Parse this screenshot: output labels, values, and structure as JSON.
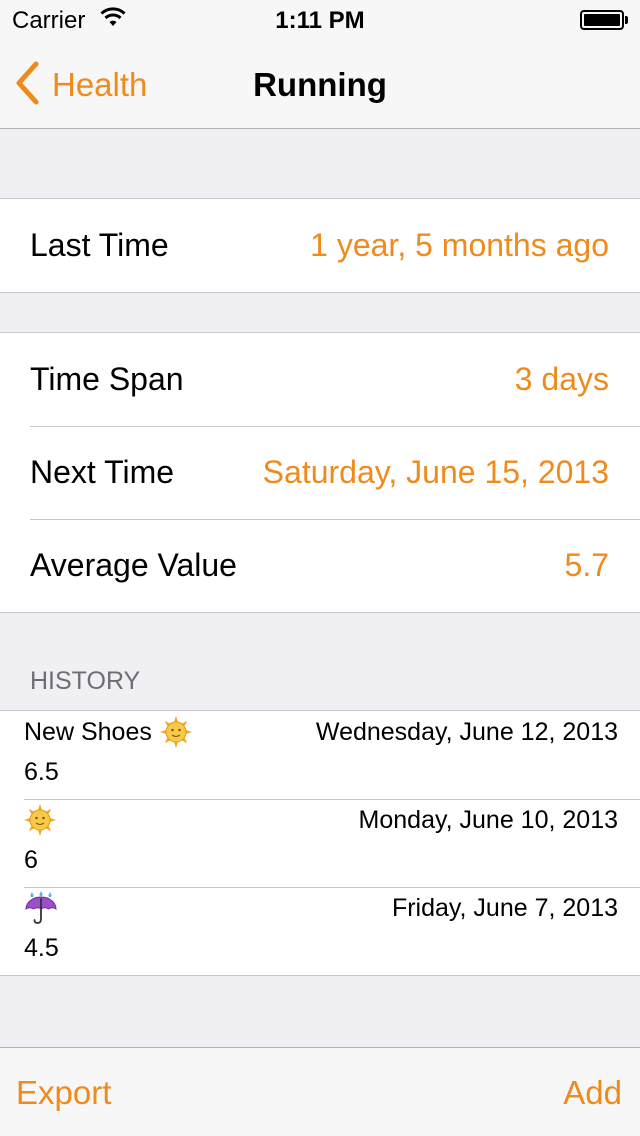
{
  "status_bar": {
    "carrier": "Carrier",
    "time": "1:11 PM"
  },
  "nav": {
    "back_label": "Health",
    "title": "Running"
  },
  "summary_group_1": {
    "rows": [
      {
        "label": "Last Time",
        "value": "1 year, 5 months ago"
      }
    ]
  },
  "summary_group_2": {
    "rows": [
      {
        "label": "Time Span",
        "value": "3 days"
      },
      {
        "label": "Next Time",
        "value": "Saturday, June 15, 2013"
      },
      {
        "label": "Average Value",
        "value": "5.7"
      }
    ]
  },
  "history": {
    "header": "HISTORY",
    "entries": [
      {
        "note": "New Shoes",
        "icon": "sun-icon",
        "date": "Wednesday, June 12, 2013",
        "value": "6.5"
      },
      {
        "note": "",
        "icon": "sun-icon",
        "date": "Monday, June 10, 2013",
        "value": "6"
      },
      {
        "note": "",
        "icon": "umbrella-icon",
        "date": "Friday, June 7, 2013",
        "value": "4.5"
      }
    ]
  },
  "toolbar": {
    "export_label": "Export",
    "add_label": "Add"
  },
  "colors": {
    "accent": "#ef8a1d",
    "background": "#efeff4",
    "separator": "#c8c7cc"
  }
}
